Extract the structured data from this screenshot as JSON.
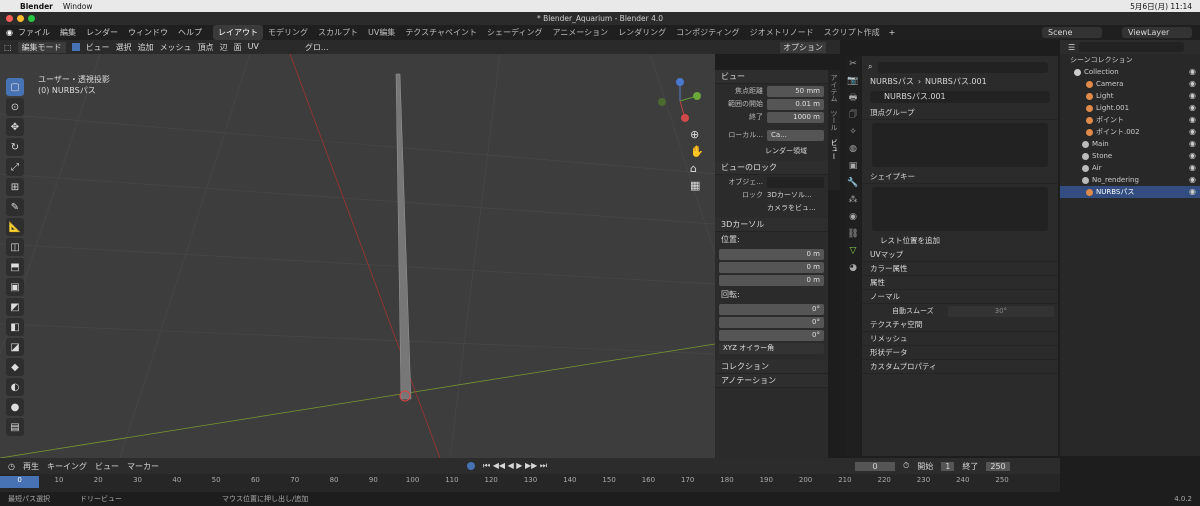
{
  "mac": {
    "apple": "",
    "app": "Blender",
    "menu": "Window",
    "time": "5月6日(月) 11:14"
  },
  "window": {
    "title": "* Blender_Aquarium - Blender 4.0"
  },
  "menus": [
    "ファイル",
    "編集",
    "レンダー",
    "ウィンドウ",
    "ヘルプ"
  ],
  "workspaces": [
    "レイアウト",
    "モデリング",
    "スカルプト",
    "UV編集",
    "テクスチャペイント",
    "シェーディング",
    "アニメーション",
    "レンダリング",
    "コンポジティング",
    "ジオメトリノード",
    "スクリプト作成"
  ],
  "scene": "Scene",
  "viewlayer": "ViewLayer",
  "vpheader": {
    "mode": "編集モード",
    "items": [
      "ビュー",
      "選択",
      "追加",
      "メッシュ",
      "頂点",
      "辺",
      "面",
      "UV"
    ],
    "transform": "グロ...",
    "options": "オプション"
  },
  "viewport": {
    "line1": "ユーザー・透視投影",
    "line2": "(0) NURBSパス"
  },
  "npanel": {
    "view_title": "ビュー",
    "focal_label": "焦点距離",
    "focal": "50 mm",
    "clip_start_label": "範囲の開始",
    "clip_start": "0.01 m",
    "clip_end_label": "終了",
    "clip_end": "1000 m",
    "local_label": "ローカル...",
    "local_val": "Ca...",
    "render_region": "レンダー領域",
    "lock_title": "ビューのロック",
    "object_label": "オブジェ...",
    "lock_label": "ロック",
    "lock_cursor": "3Dカーソル...",
    "lock_camera": "カメラをビュ...",
    "cursor_title": "3Dカーソル",
    "location_label": "位置:",
    "x": "0 m",
    "y": "0 m",
    "z": "0 m",
    "rotation_label": "回転:",
    "rx": "0°",
    "ry": "0°",
    "rz": "0°",
    "euler": "XYZ オイラー角",
    "collection": "コレクション",
    "annotation": "アノテーション",
    "tabs": [
      "アイテム",
      "ツール",
      "ビュー"
    ]
  },
  "props": {
    "breadcrumb1": "NURBSパス",
    "breadcrumb2": "NURBSパス.001",
    "datablock": "NURBSパス.001",
    "vertex_groups": "頂点グループ",
    "shape_keys": "シェイプキー",
    "rest_position": "レスト位置を追加",
    "sections": [
      "UVマップ",
      "カラー属性",
      "属性",
      "ノーマル"
    ],
    "auto_smooth": "自動スムーズ",
    "auto_smooth_angle": "30°",
    "sections2": [
      "テクスチャ空間",
      "リメッシュ",
      "形状データ",
      "カスタムプロパティ"
    ]
  },
  "outliner": {
    "title": "シーンコレクション",
    "rows": [
      {
        "name": "Collection",
        "color": "#cccccc"
      },
      {
        "name": "Camera",
        "color": "#e08a4a"
      },
      {
        "name": "Light",
        "color": "#e08a4a"
      },
      {
        "name": "Light.001",
        "color": "#e08a4a"
      },
      {
        "name": "ポイント",
        "color": "#e08a4a"
      },
      {
        "name": "ポイント.002",
        "color": "#e08a4a"
      },
      {
        "name": "Main",
        "color": "#bbbbbb"
      },
      {
        "name": "Stone",
        "color": "#bbbbbb"
      },
      {
        "name": "Air",
        "color": "#bbbbbb"
      },
      {
        "name": "No_rendering",
        "color": "#bbbbbb"
      },
      {
        "name": "NURBSパス",
        "color": "#e08a4a"
      }
    ]
  },
  "timeline": {
    "playback": "再生",
    "keying": "キーイング",
    "view": "ビュー",
    "marker": "マーカー",
    "current": "0",
    "start_label": "開始",
    "start": "1",
    "end_label": "終了",
    "end": "250",
    "ticks": [
      "0",
      "10",
      "20",
      "30",
      "40",
      "50",
      "60",
      "70",
      "80",
      "90",
      "100",
      "110",
      "120",
      "130",
      "140",
      "150",
      "160",
      "170",
      "180",
      "190",
      "200",
      "210",
      "220",
      "230",
      "240",
      "250"
    ]
  },
  "status": {
    "s1": "最短パス選択",
    "s2": "ドリービュー",
    "s3": "マウス位置に押し出し/追加",
    "version": "4.0.2"
  }
}
